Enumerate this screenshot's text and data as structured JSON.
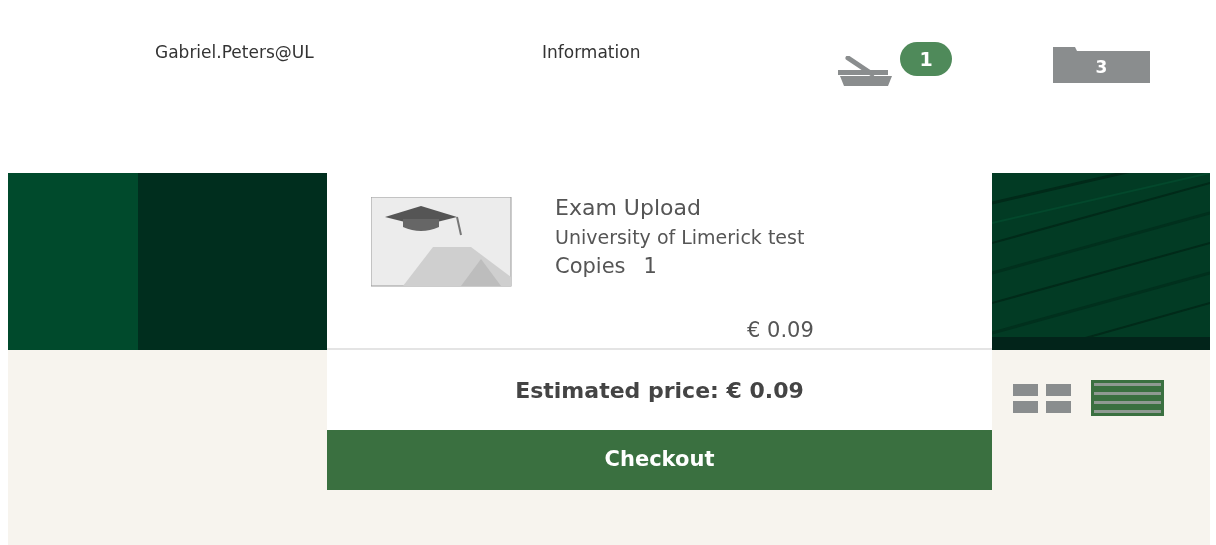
{
  "header": {
    "user": "Gabriel.Peters@UL",
    "info_link": "Information",
    "cart_count": "1",
    "folder_count": "3"
  },
  "cart_panel": {
    "items": [
      {
        "title": "Exam Upload",
        "subtitle": "University of Limerick test",
        "copies_label": "Copies",
        "copies": "1",
        "price": "€ 0.09"
      }
    ],
    "estimated_price": "Estimated price: € 0.09",
    "checkout": "Checkout"
  },
  "view_toggles": [
    {
      "kind": "grid",
      "selected": false
    },
    {
      "kind": "list",
      "selected": true
    }
  ]
}
